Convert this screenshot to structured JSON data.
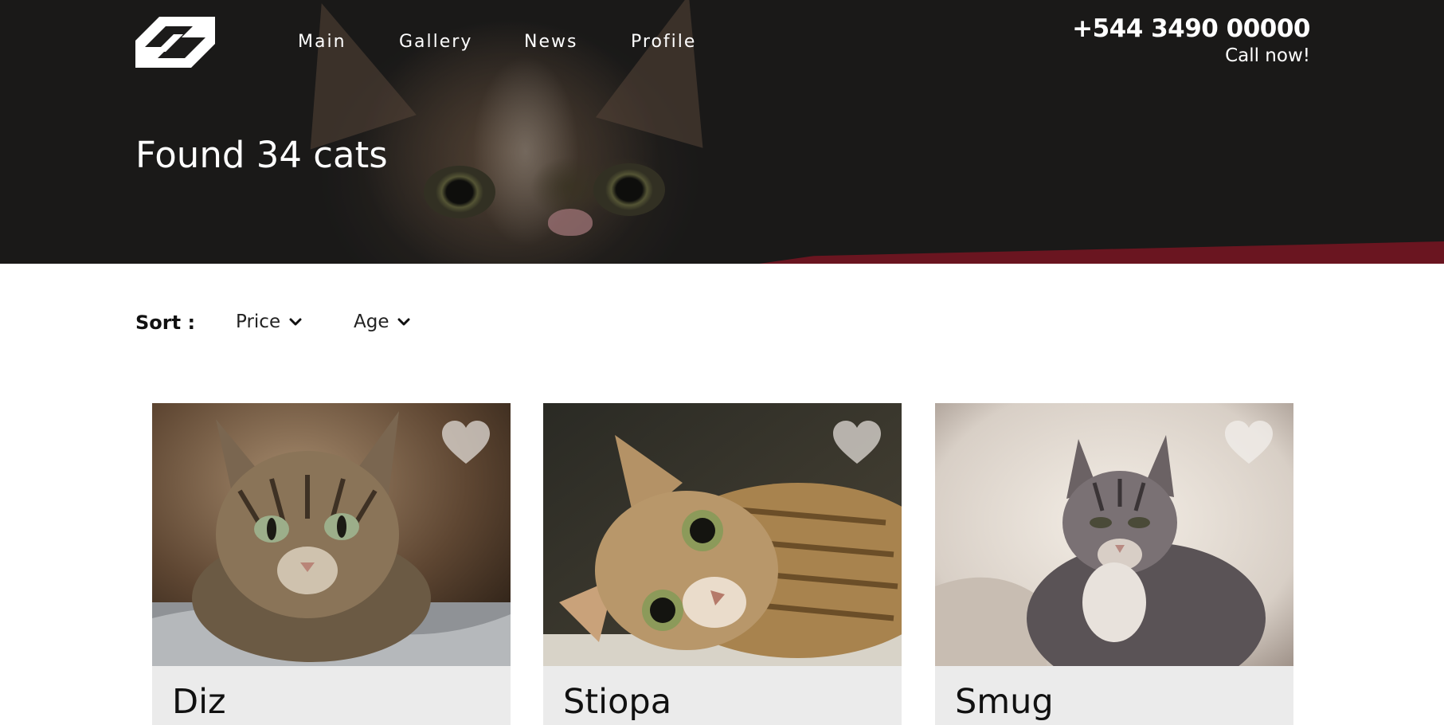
{
  "header": {
    "nav": [
      {
        "label": "Main"
      },
      {
        "label": "Gallery"
      },
      {
        "label": "News"
      },
      {
        "label": "Profile"
      }
    ],
    "phone": "+544 3490 00000",
    "call_now": "Call now!"
  },
  "hero": {
    "title": "Found 34 cats"
  },
  "sort": {
    "label": "Sort :",
    "options": [
      {
        "label": "Price",
        "icon": "chevron-down-icon"
      },
      {
        "label": "Age",
        "icon": "chevron-down-icon"
      }
    ]
  },
  "cats": [
    {
      "name": "Diz",
      "favorite_icon": "heart-icon"
    },
    {
      "name": "Stiopa",
      "favorite_icon": "heart-icon"
    },
    {
      "name": "Smug",
      "favorite_icon": "heart-icon"
    }
  ],
  "colors": {
    "header_bg": "#1c1b1a",
    "accent_red": "#6a1520",
    "card_bg": "#ebebeb",
    "text_dark": "#111111",
    "text_light": "#ffffff"
  }
}
